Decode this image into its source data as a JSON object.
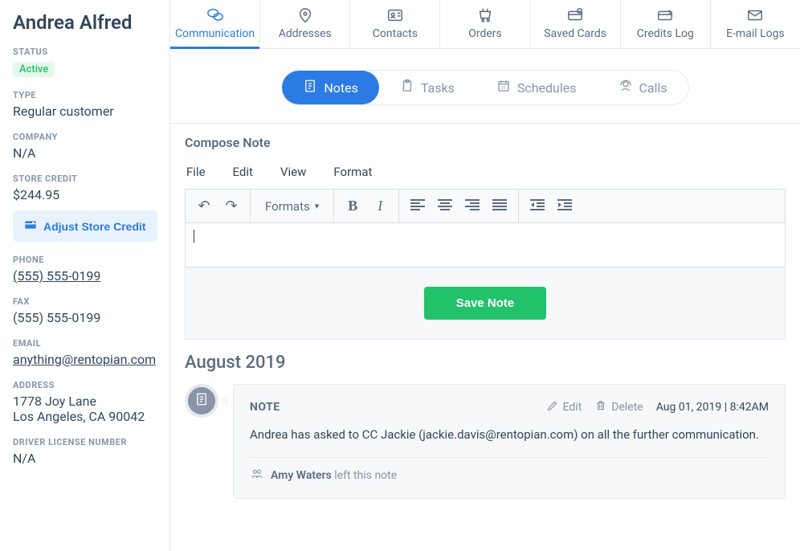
{
  "customer": {
    "name": "Andrea Alfred",
    "status_label": "STATUS",
    "status_value": "Active",
    "type_label": "TYPE",
    "type_value": "Regular customer",
    "company_label": "COMPANY",
    "company_value": "N/A",
    "credit_label": "STORE CREDIT",
    "credit_value": "$244.95",
    "adjust_button": "Adjust Store Credit",
    "phone_label": "PHONE",
    "phone_value": "(555) 555-0199",
    "fax_label": "FAX",
    "fax_value": "(555) 555-0199",
    "email_label": "EMAIL",
    "email_value": "anything@rentopian.com",
    "address_label": "ADDRESS",
    "address_line1": "1778 Joy Lane",
    "address_line2": "Los Angeles, CA 90042",
    "dl_label": "DRIVER LICENSE NUMBER",
    "dl_value": "N/A"
  },
  "top_tabs": {
    "communication": "Communication",
    "addresses": "Addresses",
    "contacts": "Contacts",
    "orders": "Orders",
    "saved_cards": "Saved Cards",
    "credits_log": "Credits Log",
    "email_logs": "E-mail Logs"
  },
  "sub_tabs": {
    "notes": "Notes",
    "tasks": "Tasks",
    "schedules": "Schedules",
    "calls": "Calls"
  },
  "compose": {
    "title": "Compose Note",
    "menu_file": "File",
    "menu_edit": "Edit",
    "menu_view": "View",
    "menu_format": "Format",
    "formats_label": "Formats",
    "save_button": "Save Note"
  },
  "notes": {
    "month": "August 2019",
    "item": {
      "type_label": "NOTE",
      "edit_label": "Edit",
      "delete_label": "Delete",
      "timestamp": "Aug 01, 2019 | 8:42AM",
      "body": "Andrea has asked to CC Jackie (jackie.davis@rentopian.com) on all the further communication.",
      "author_name": "Amy Waters",
      "author_suffix": " left this note"
    }
  }
}
